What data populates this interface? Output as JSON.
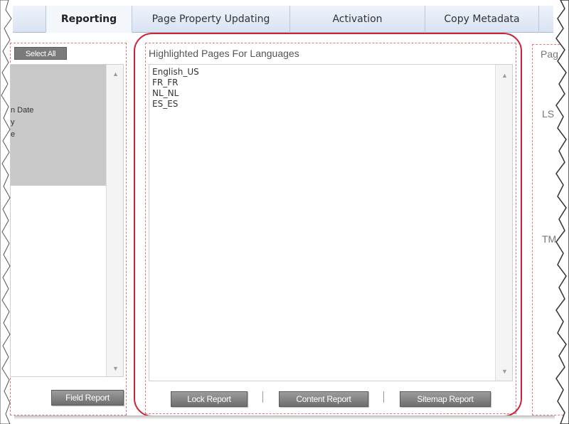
{
  "tabs": [
    {
      "label": "Reporting",
      "active": true
    },
    {
      "label": "Page Property Updating",
      "active": false
    },
    {
      "label": "Activation",
      "active": false
    },
    {
      "label": "Copy Metadata",
      "active": false
    }
  ],
  "left_panel": {
    "select_all": "Select All",
    "items": [
      "n Date",
      "y",
      "e"
    ],
    "field_report": "Field Report"
  },
  "middle_panel": {
    "title": "Highlighted Pages For Languages",
    "languages": [
      "English_US",
      "FR_FR",
      "NL_NL",
      "ES_ES"
    ],
    "lock_report": "Lock Report",
    "content_report": "Content Report",
    "sitemap_report": "Sitemap Report"
  },
  "right_panel": {
    "title_partial": "Pag",
    "label_ls": "LS",
    "label_tm": "TM"
  },
  "colors": {
    "highlight_ring": "#cc2233",
    "tab_bar": "#d9e3f2",
    "button": "#7a7a7a"
  }
}
